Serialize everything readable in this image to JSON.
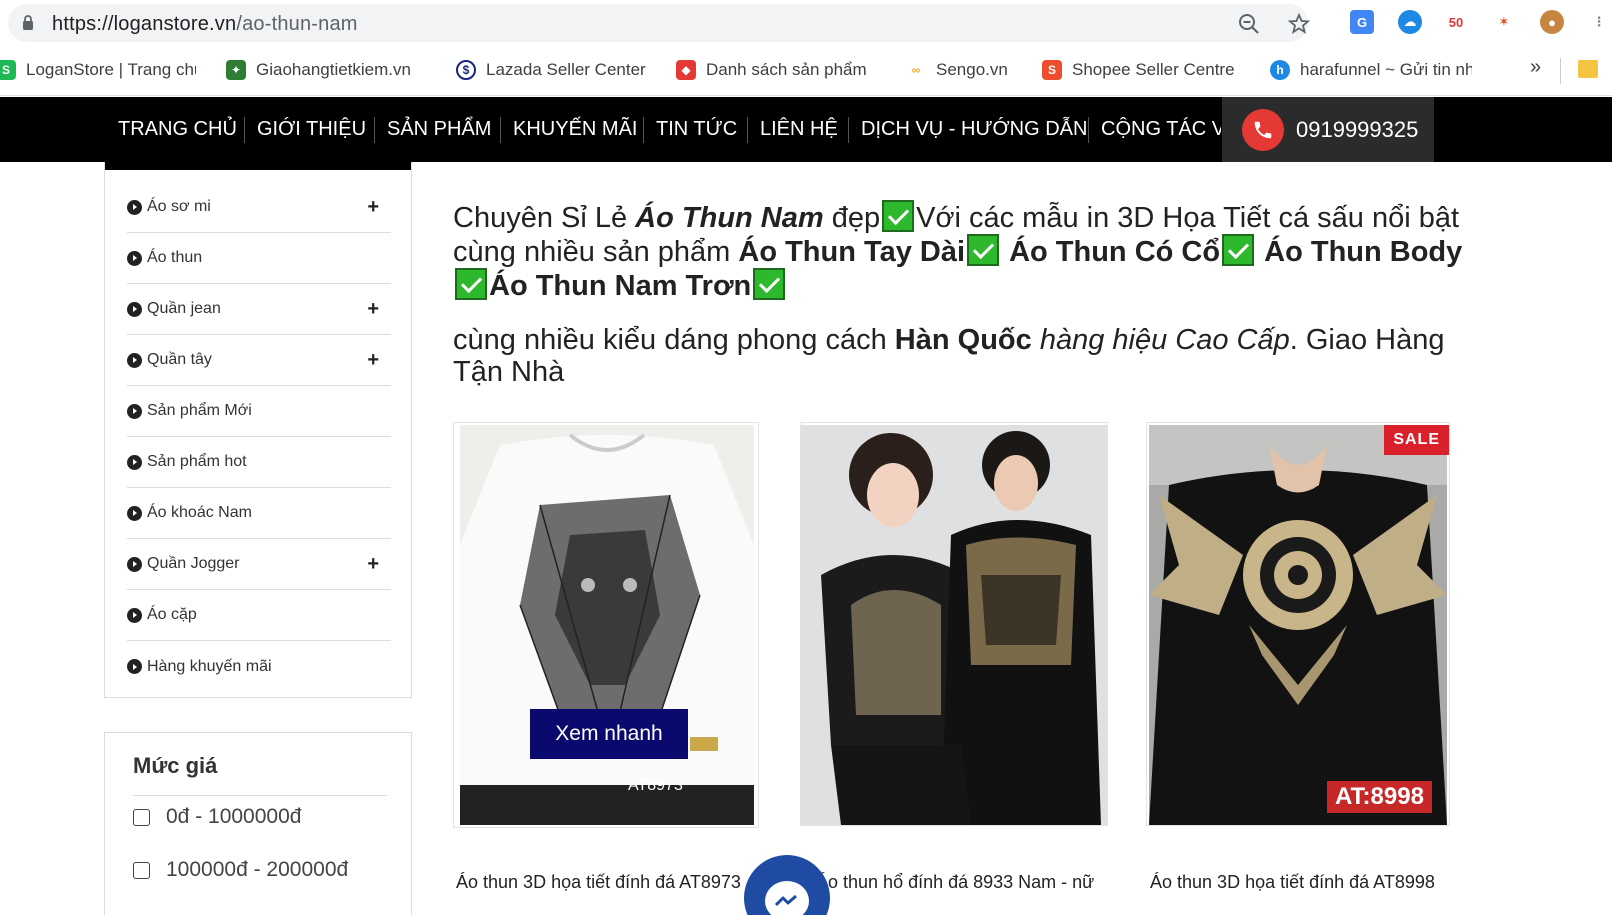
{
  "browser": {
    "url_host": "https://loganstore.vn",
    "url_path": "/ao-thun-nam",
    "bookmarks": [
      {
        "label": "LoganStore | Trang chủ",
        "color": "#1db954"
      },
      {
        "label": "Giaohangtietkiem.vn",
        "color": "#2e7d32"
      },
      {
        "label": "Lazada Seller Center",
        "color": "#1a237e"
      },
      {
        "label": "Danh sách sản phẩm",
        "color": "#e53935"
      },
      {
        "label": "Sengo.vn",
        "color": "#f9a825"
      },
      {
        "label": "Shopee Seller Centre",
        "color": "#ee4d2d"
      },
      {
        "label": "harafunnel ~ Gửi tin nhắn",
        "color": "#1e88e5"
      }
    ],
    "more": "»"
  },
  "nav": {
    "items": [
      "TRANG CHỦ",
      "GIỚI THIỆU",
      "SẢN PHẨM",
      "KHUYẾN MÃI",
      "TIN TỨC",
      "LIÊN HỆ",
      "DỊCH VỤ - HƯỚNG DẪN",
      "CỘNG TÁC VIÊN"
    ],
    "phone": "0919999325"
  },
  "sidebar": {
    "categories": [
      {
        "label": "Áo sơ mi",
        "expandable": true
      },
      {
        "label": "Áo thun",
        "expandable": false
      },
      {
        "label": "Quần jean",
        "expandable": true
      },
      {
        "label": "Quần tây",
        "expandable": true
      },
      {
        "label": "Sản phẩm Mới",
        "expandable": false
      },
      {
        "label": "Sản phẩm hot",
        "expandable": false
      },
      {
        "label": "Áo khoác Nam",
        "expandable": false
      },
      {
        "label": "Quần Jogger",
        "expandable": true
      },
      {
        "label": "Áo cặp",
        "expandable": false
      },
      {
        "label": "Hàng khuyến mãi",
        "expandable": false
      }
    ],
    "plus": "+",
    "price": {
      "title": "Mức giá",
      "options": [
        "0đ - 1000000đ",
        "100000đ - 200000đ"
      ]
    }
  },
  "intro": {
    "p1_a": " Chuyên Sỉ Lẻ ",
    "p1_b": "Áo Thun Nam",
    "p1_c": " đẹp",
    "p1_d": "Với các mẫu in 3D Họa Tiết cá sấu nổi bật cùng nhiều sản phẩm ",
    "p1_e": "Áo Thun Tay Dài",
    "p1_f": " Áo Thun Có Cổ",
    "p1_g": " Áo Thun Body",
    "p1_h": "Áo Thun Nam Trơn",
    "p2_a": "cùng nhiều kiểu dáng phong cách ",
    "p2_b": "Hàn Quốc",
    "p2_c": " ",
    "p2_d": "hàng hiệu Cao Cấp",
    "p2_e": ". Giao Hàng Tận Nhà"
  },
  "products": [
    {
      "name": "Áo thun 3D họa tiết đính đá AT8973",
      "code": "AT8973",
      "quick_view": "Xem nhanh"
    },
    {
      "name": "Áo thun hổ đính đá 8933 Nam - nữ",
      "code": ""
    },
    {
      "name": "Áo thun 3D họa tiết đính đá AT8998",
      "code": "AT:8998",
      "badge": "SALE"
    }
  ],
  "colors": {
    "nav_bg": "#000000",
    "phone_red": "#e53935",
    "quick_btn": "#0a0a6e",
    "sale_red": "#d9202b",
    "check_green": "#2eb82e",
    "messenger_blue": "#1f4ba3"
  }
}
